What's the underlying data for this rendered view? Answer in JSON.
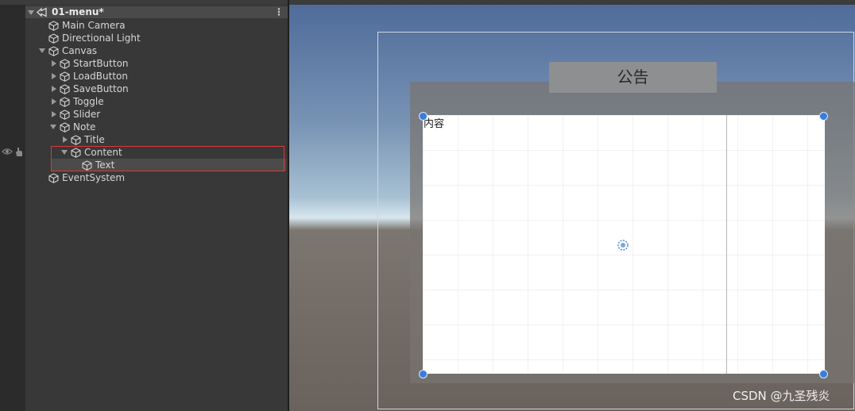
{
  "hierarchy": {
    "scene_name": "01-menu*",
    "items": [
      {
        "label": "Main Camera",
        "depth": 0,
        "expand": "none"
      },
      {
        "label": "Directional Light",
        "depth": 0,
        "expand": "none"
      },
      {
        "label": "Canvas",
        "depth": 0,
        "expand": "expanded"
      },
      {
        "label": "StartButton",
        "depth": 1,
        "expand": "collapsed"
      },
      {
        "label": "LoadButton",
        "depth": 1,
        "expand": "collapsed"
      },
      {
        "label": "SaveButton",
        "depth": 1,
        "expand": "collapsed"
      },
      {
        "label": "Toggle",
        "depth": 1,
        "expand": "collapsed"
      },
      {
        "label": "Slider",
        "depth": 1,
        "expand": "collapsed"
      },
      {
        "label": "Note",
        "depth": 1,
        "expand": "expanded"
      },
      {
        "label": "Title",
        "depth": 2,
        "expand": "collapsed"
      },
      {
        "label": "Content",
        "depth": 2,
        "expand": "expanded"
      },
      {
        "label": "Text",
        "depth": 3,
        "expand": "none"
      },
      {
        "label": "EventSystem",
        "depth": 0,
        "expand": "none"
      }
    ]
  },
  "scene_view": {
    "title_text": "公告",
    "content_text": "内容"
  },
  "watermark": "CSDN @九圣残炎",
  "colors": {
    "selection_outline": "#e0383a",
    "handle": "#3b7ddd",
    "panel_bg": "#383838"
  }
}
